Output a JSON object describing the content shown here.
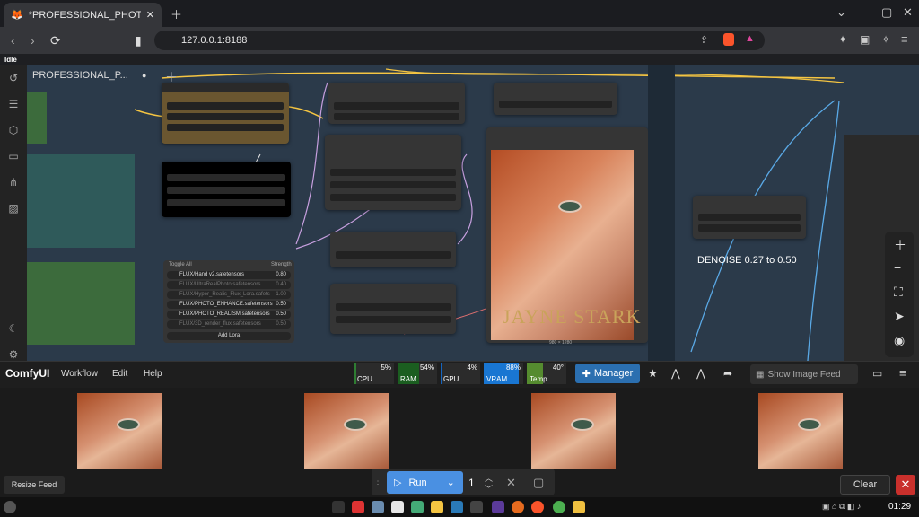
{
  "browser": {
    "tab_title": "*PROFESSIONAL_PHOTOG",
    "url": "127.0.0.1:8188",
    "status": "Idle"
  },
  "canvas": {
    "workflow_title": "PROFESSIONAL_P...",
    "note": "DENOISE 0.27 to 0.50",
    "image_caption": "JAYNE STARK",
    "image_dims": "980 × 1280"
  },
  "lora": {
    "toggle_all": "Toggle All",
    "strength_label": "Strength",
    "add_label": "Add Lora",
    "items": [
      {
        "name": "FLUX/Hand v2.safetensors",
        "value": "0.80",
        "on": true
      },
      {
        "name": "FLUX/UltraRealPhoto.safetensors",
        "value": "0.40",
        "on": false
      },
      {
        "name": "FLUX/Hyper_Realis_Flux_Lora.safets",
        "value": "1.00",
        "on": false
      },
      {
        "name": "FLUX/PHOTO_ENHANCE.safetensors",
        "value": "0.50",
        "on": true
      },
      {
        "name": "FLUX/PHOTO_REALISM.safetensors",
        "value": "0.50",
        "on": true
      },
      {
        "name": "FLUX/3D_render_flux.safetensors",
        "value": "0.50",
        "on": false
      }
    ]
  },
  "menubar": {
    "app": "ComfyUI",
    "items": [
      "Workflow",
      "Edit",
      "Help"
    ],
    "monitors": [
      {
        "label": "CPU",
        "pct": "5%",
        "color": "#2e7d32"
      },
      {
        "label": "RAM",
        "pct": "54%",
        "color": "#1b5e20"
      },
      {
        "label": "GPU",
        "pct": "4%",
        "color": "#1565c0"
      },
      {
        "label": "VRAM",
        "pct": "88%",
        "color": "#1976d2"
      },
      {
        "label": "Temp",
        "pct": "40°",
        "color": "#558b2f"
      }
    ],
    "manager": "Manager",
    "feed": "Show Image Feed"
  },
  "feed": {
    "resize": "Resize Feed",
    "clear": "Clear"
  },
  "run": {
    "label": "Run",
    "count": "1"
  },
  "taskbar": {
    "time": "01:29"
  }
}
